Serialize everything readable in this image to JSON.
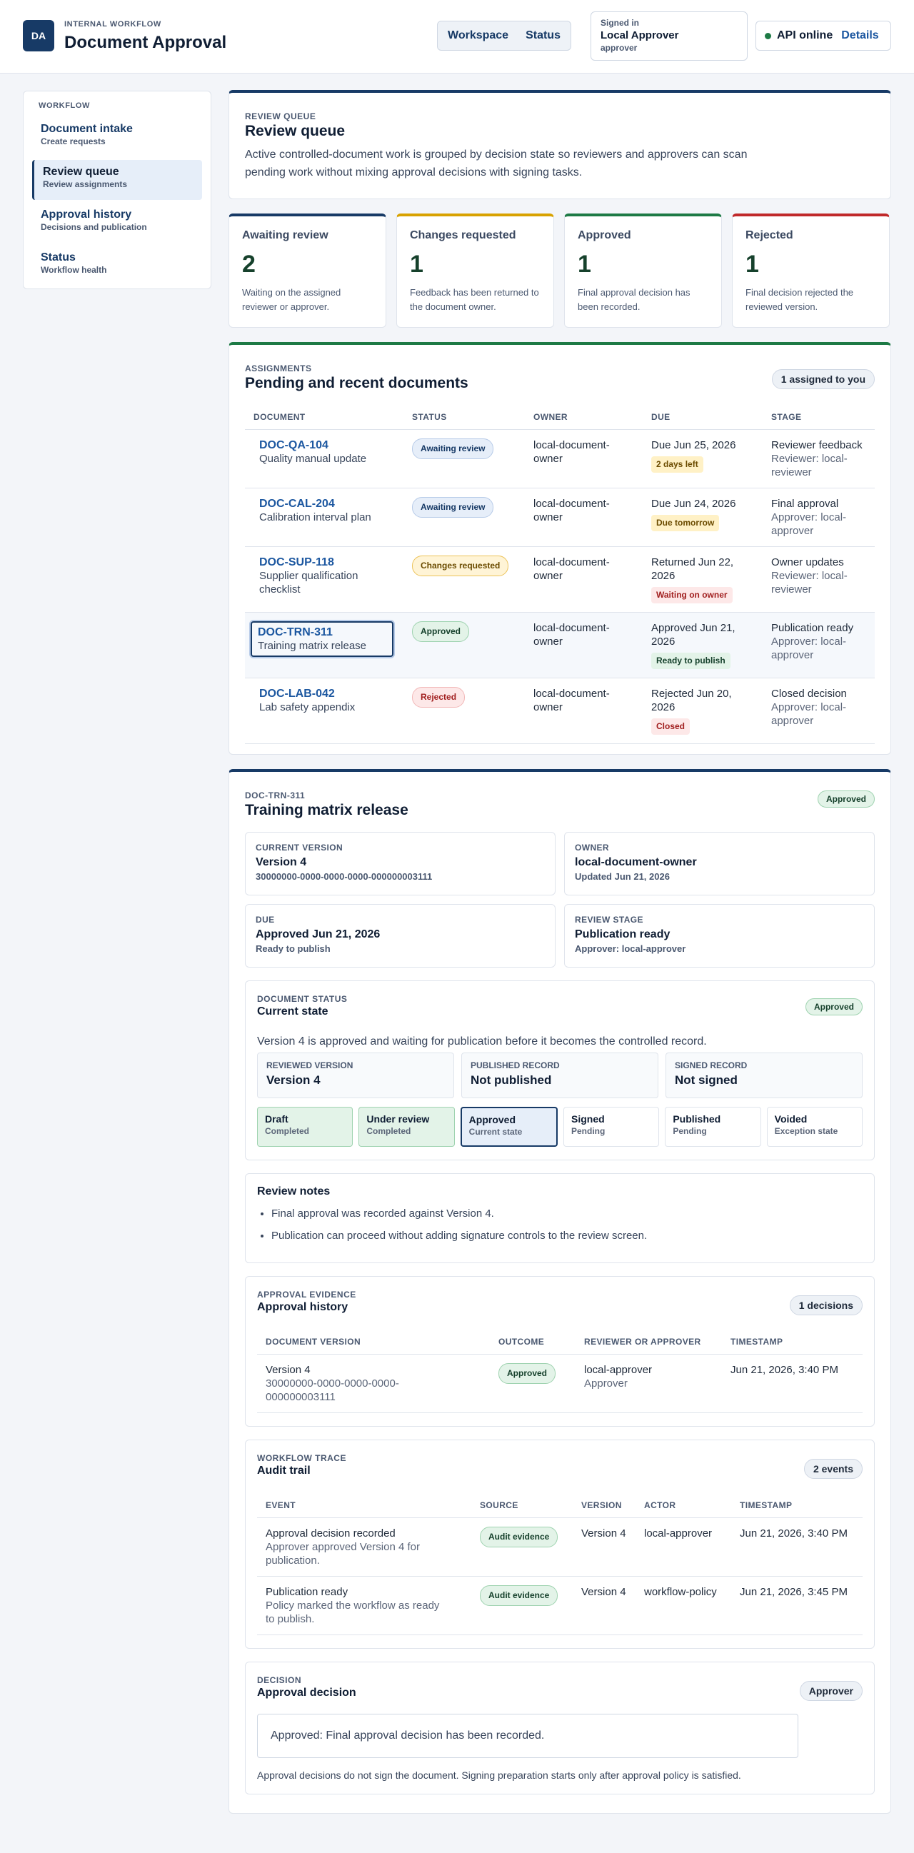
{
  "header": {
    "logo": "DA",
    "kicker": "INTERNAL WORKFLOW",
    "title": "Document Approval",
    "nav": [
      "Workspace",
      "Status"
    ],
    "signed_label": "Signed in",
    "signed_name": "Local Approver",
    "signed_role": "approver",
    "api_status": "API online",
    "api_details": "Details"
  },
  "sidebar": {
    "kicker": "WORKFLOW",
    "items": [
      {
        "label": "Document intake",
        "sub": "Create requests"
      },
      {
        "label": "Review queue",
        "sub": "Review assignments"
      },
      {
        "label": "Approval history",
        "sub": "Decisions and publication"
      },
      {
        "label": "Status",
        "sub": "Workflow health"
      }
    ]
  },
  "queue": {
    "kicker": "REVIEW QUEUE",
    "title": "Review queue",
    "description": "Active controlled-document work is grouped by decision state so reviewers and approvers can scan pending work without mixing approval decisions with signing tasks."
  },
  "metrics": [
    {
      "label": "Awaiting review",
      "value": "2",
      "desc": "Waiting on the assigned reviewer or approver."
    },
    {
      "label": "Changes requested",
      "value": "1",
      "desc": "Feedback has been returned to the document owner."
    },
    {
      "label": "Approved",
      "value": "1",
      "desc": "Final approval decision has been recorded."
    },
    {
      "label": "Rejected",
      "value": "1",
      "desc": "Final decision rejected the reviewed version."
    }
  ],
  "assignments": {
    "kicker": "ASSIGNMENTS",
    "title": "Pending and recent documents",
    "badge": "1 assigned to you",
    "columns": [
      "DOCUMENT",
      "STATUS",
      "OWNER",
      "DUE",
      "STAGE"
    ],
    "rows": [
      {
        "id": "DOC-QA-104",
        "name": "Quality manual update",
        "status": "Awaiting review",
        "owner": "local-document-owner",
        "due": "Due Jun 25, 2026",
        "due_tag": "2 days left",
        "stage": "Reviewer feedback",
        "stage_sub": "Reviewer: local-reviewer"
      },
      {
        "id": "DOC-CAL-204",
        "name": "Calibration interval plan",
        "status": "Awaiting review",
        "owner": "local-document-owner",
        "due": "Due Jun 24, 2026",
        "due_tag": "Due tomorrow",
        "stage": "Final approval",
        "stage_sub": "Approver: local-approver"
      },
      {
        "id": "DOC-SUP-118",
        "name": "Supplier qualification checklist",
        "status": "Changes requested",
        "owner": "local-document-owner",
        "due": "Returned Jun 22, 2026",
        "due_tag": "Waiting on owner",
        "stage": "Owner updates",
        "stage_sub": "Reviewer: local-reviewer"
      },
      {
        "id": "DOC-TRN-311",
        "name": "Training matrix release",
        "status": "Approved",
        "owner": "local-document-owner",
        "due": "Approved Jun 21, 2026",
        "due_tag": "Ready to publish",
        "stage": "Publication ready",
        "stage_sub": "Approver: local-approver"
      },
      {
        "id": "DOC-LAB-042",
        "name": "Lab safety appendix",
        "status": "Rejected",
        "owner": "local-document-owner",
        "due": "Rejected Jun 20, 2026",
        "due_tag": "Closed",
        "stage": "Closed decision",
        "stage_sub": "Approver: local-approver"
      }
    ]
  },
  "detail": {
    "kicker": "DOC-TRN-311",
    "title": "Training matrix release",
    "badge": "Approved",
    "info": [
      {
        "k": "CURRENT VERSION",
        "v": "Version 4",
        "s": "30000000-0000-0000-0000-000000003111"
      },
      {
        "k": "OWNER",
        "v": "local-document-owner",
        "s": "Updated Jun 21, 2026"
      },
      {
        "k": "DUE",
        "v": "Approved Jun 21, 2026",
        "s": "Ready to publish"
      },
      {
        "k": "REVIEW STAGE",
        "v": "Publication ready",
        "s": "Approver: local-approver"
      }
    ],
    "status": {
      "kicker": "DOCUMENT STATUS",
      "title": "Current state",
      "badge": "Approved",
      "text": "Version 4 is approved and waiting for publication before it becomes the controlled record.",
      "records": [
        {
          "k": "REVIEWED VERSION",
          "v": "Version 4"
        },
        {
          "k": "PUBLISHED RECORD",
          "v": "Not published"
        },
        {
          "k": "SIGNED RECORD",
          "v": "Not signed"
        }
      ],
      "steps": [
        {
          "t": "Draft",
          "s": "Completed"
        },
        {
          "t": "Under review",
          "s": "Completed"
        },
        {
          "t": "Approved",
          "s": "Current state"
        },
        {
          "t": "Signed",
          "s": "Pending"
        },
        {
          "t": "Published",
          "s": "Pending"
        },
        {
          "t": "Voided",
          "s": "Exception state"
        }
      ]
    },
    "notes": {
      "title": "Review notes",
      "items": [
        "Final approval was recorded against Version 4.",
        "Publication can proceed without adding signature controls to the review screen."
      ]
    },
    "history": {
      "kicker": "APPROVAL EVIDENCE",
      "title": "Approval history",
      "badge": "1 decisions",
      "columns": [
        "DOCUMENT VERSION",
        "OUTCOME",
        "REVIEWER OR APPROVER",
        "TIMESTAMP"
      ],
      "rows": [
        {
          "version": "Version 4",
          "version_id": "30000000-0000-0000-0000-000000003111",
          "outcome": "Approved",
          "who": "local-approver",
          "role": "Approver",
          "ts": "Jun 21, 2026, 3:40 PM"
        }
      ]
    },
    "audit": {
      "kicker": "WORKFLOW TRACE",
      "title": "Audit trail",
      "badge": "2 events",
      "columns": [
        "EVENT",
        "SOURCE",
        "VERSION",
        "ACTOR",
        "TIMESTAMP"
      ],
      "rows": [
        {
          "event": "Approval decision recorded",
          "desc": "Approver approved Version 4 for publication.",
          "source": "Audit evidence",
          "version": "Version 4",
          "actor": "local-approver",
          "ts": "Jun 21, 2026, 3:40 PM"
        },
        {
          "event": "Publication ready",
          "desc": "Policy marked the workflow as ready to publish.",
          "source": "Audit evidence",
          "version": "Version 4",
          "actor": "workflow-policy",
          "ts": "Jun 21, 2026, 3:45 PM"
        }
      ]
    },
    "decision": {
      "kicker": "DECISION",
      "title": "Approval decision",
      "badge": "Approver",
      "message": "Approved: Final approval decision has been recorded.",
      "note": "Approval decisions do not sign the document. Signing preparation starts only after approval policy is satisfied."
    }
  }
}
